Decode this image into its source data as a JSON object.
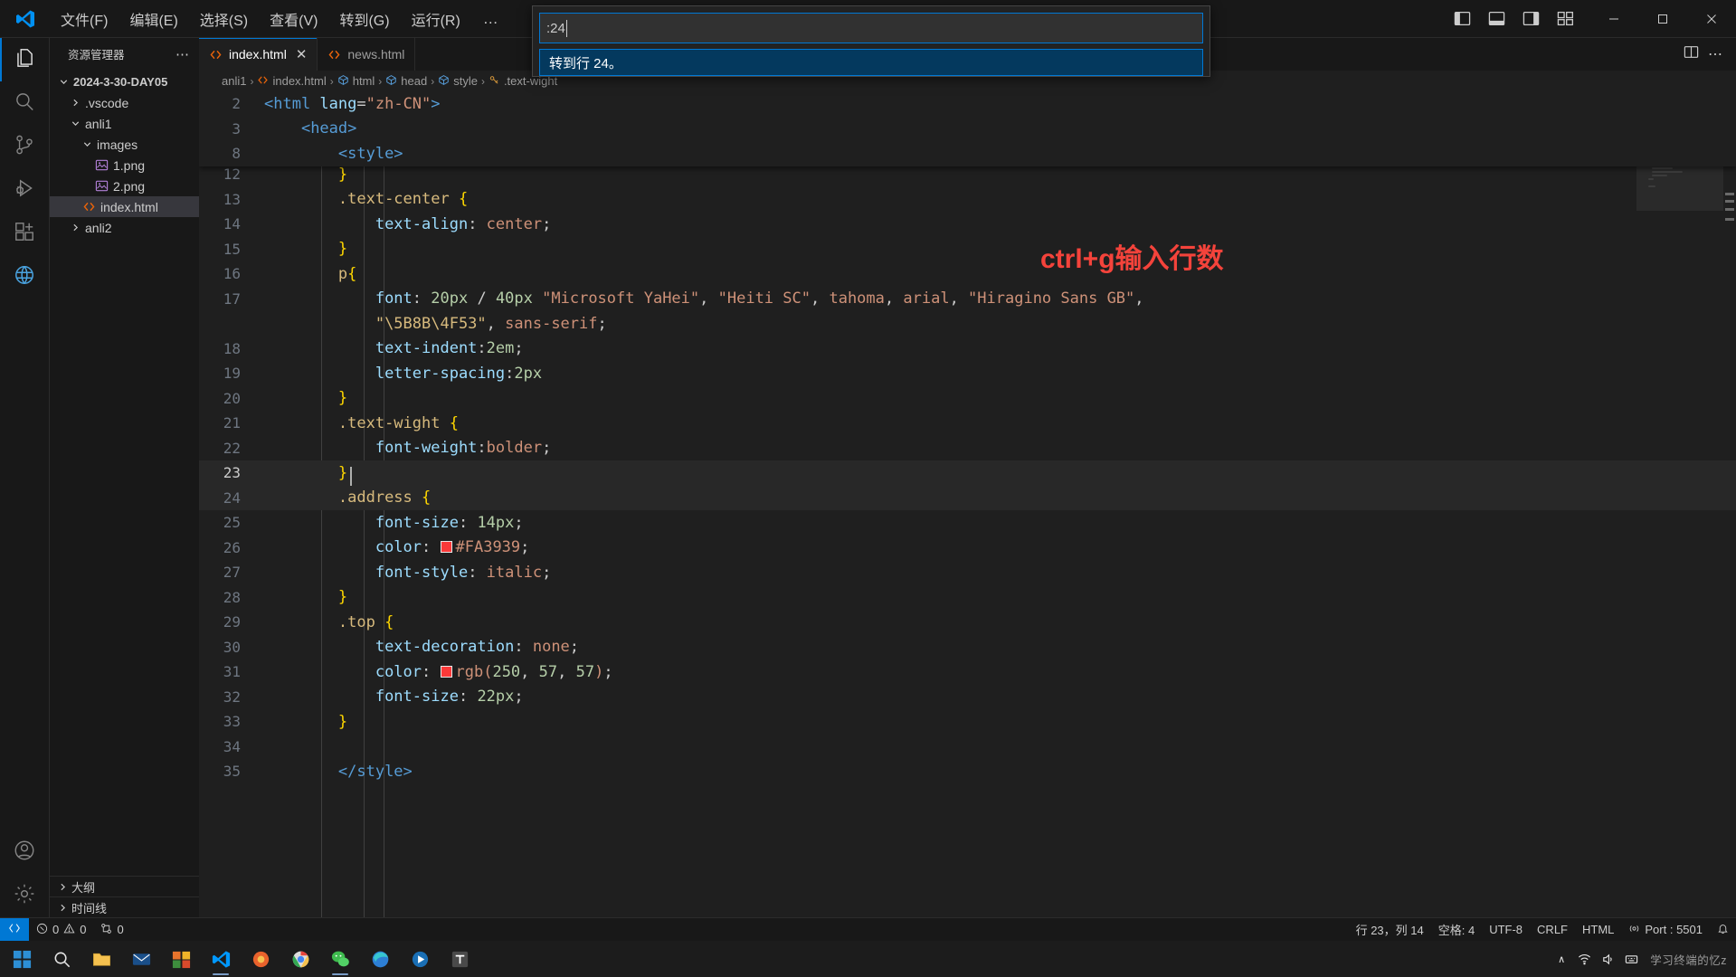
{
  "titlebar": {
    "logo_icon": "vscode-logo-icon",
    "menus": [
      {
        "label": "文件(F)"
      },
      {
        "label": "编辑(E)"
      },
      {
        "label": "选择(S)"
      },
      {
        "label": "查看(V)"
      },
      {
        "label": "转到(G)"
      },
      {
        "label": "运行(R)"
      }
    ],
    "overflow_label": "…",
    "layout_icons": [
      {
        "name": "toggle-primary-sidebar-icon"
      },
      {
        "name": "toggle-panel-icon"
      },
      {
        "name": "toggle-secondary-sidebar-icon"
      },
      {
        "name": "customize-layout-icon"
      }
    ],
    "window_controls": {
      "minimize": "─",
      "maximize": "☐",
      "close": "✕"
    }
  },
  "quick_input": {
    "value": ":24",
    "placeholder": "",
    "suggestion": "转到行 24。"
  },
  "activitybar": {
    "items": [
      {
        "name": "explorer",
        "icon": "files-icon",
        "active": true
      },
      {
        "name": "search",
        "icon": "search-icon",
        "active": false
      },
      {
        "name": "source-control",
        "icon": "source-control-icon",
        "active": false
      },
      {
        "name": "run-and-debug",
        "icon": "debug-icon",
        "active": false
      },
      {
        "name": "extensions",
        "icon": "extensions-icon",
        "active": false
      },
      {
        "name": "live-server",
        "icon": "browser-icon",
        "active": false
      }
    ],
    "bottom_items": [
      {
        "name": "accounts",
        "icon": "account-icon"
      },
      {
        "name": "manage",
        "icon": "gear-icon"
      }
    ]
  },
  "sidebar": {
    "title": "资源管理器",
    "more_actions": "⋯",
    "tree": [
      {
        "label": "2024-3-30-DAY05",
        "indent": 0,
        "chevron": "down",
        "icon": "none",
        "kind": "root",
        "selected": false
      },
      {
        "label": ".vscode",
        "indent": 1,
        "chevron": "right",
        "icon": "none",
        "kind": "folder",
        "selected": false
      },
      {
        "label": "anli1",
        "indent": 1,
        "chevron": "down",
        "icon": "none",
        "kind": "folder",
        "selected": false
      },
      {
        "label": "images",
        "indent": 2,
        "chevron": "down",
        "icon": "none",
        "kind": "folder",
        "selected": false
      },
      {
        "label": "1.png",
        "indent": 3,
        "chevron": "none",
        "icon": "image-icon",
        "kind": "file",
        "selected": false
      },
      {
        "label": "2.png",
        "indent": 3,
        "chevron": "none",
        "icon": "image-icon",
        "kind": "file",
        "selected": false
      },
      {
        "label": "index.html",
        "indent": 2,
        "chevron": "none",
        "icon": "html-icon",
        "kind": "file",
        "selected": true
      },
      {
        "label": "anli2",
        "indent": 1,
        "chevron": "right",
        "icon": "none",
        "kind": "folder",
        "selected": false
      }
    ],
    "sections": [
      {
        "label": "大纲",
        "chevron": "right"
      },
      {
        "label": "时间线",
        "chevron": "right"
      }
    ]
  },
  "editor": {
    "tabs": [
      {
        "label": "index.html",
        "icon": "html-icon",
        "active": true,
        "close": "✕"
      },
      {
        "label": "news.html",
        "icon": "html-icon",
        "active": false,
        "close": ""
      }
    ],
    "tab_actions": [
      {
        "name": "split-editor-icon"
      },
      {
        "name": "more-actions-icon",
        "label": "⋯"
      }
    ],
    "breadcrumbs": [
      {
        "label": "anli1",
        "icon": "none"
      },
      {
        "label": "index.html",
        "icon": "html-icon"
      },
      {
        "label": "html",
        "icon": "symbol-html-icon"
      },
      {
        "label": "head",
        "icon": "symbol-head-icon"
      },
      {
        "label": "style",
        "icon": "symbol-style-icon"
      },
      {
        "label": ".text-wight",
        "icon": "symbol-rule-icon"
      }
    ],
    "separator": "›",
    "sticky_lines": [
      {
        "num": "2",
        "segments": [
          {
            "t": "<html ",
            "c": "t-tag"
          },
          {
            "t": "lang",
            "c": "t-attr"
          },
          {
            "t": "=",
            "c": "t-punc"
          },
          {
            "t": "\"zh-CN\"",
            "c": "t-str"
          },
          {
            "t": ">",
            "c": "t-tag"
          }
        ],
        "indent": 0
      },
      {
        "num": "3",
        "segments": [
          {
            "t": "<head>",
            "c": "t-tag"
          }
        ],
        "indent": 4
      },
      {
        "num": "8",
        "segments": [
          {
            "t": "<style>",
            "c": "t-tag"
          }
        ],
        "indent": 8
      }
    ],
    "lines": [
      {
        "num": "12",
        "indent": 8,
        "segments": [
          {
            "t": "}",
            "c": "t-brace"
          }
        ],
        "partial": true
      },
      {
        "num": "13",
        "indent": 8,
        "segments": [
          {
            "t": ".text-center ",
            "c": "t-sel"
          },
          {
            "t": "{",
            "c": "t-brace"
          }
        ]
      },
      {
        "num": "14",
        "indent": 12,
        "segments": [
          {
            "t": "text-align",
            "c": "t-prop"
          },
          {
            "t": ": ",
            "c": "t-punc"
          },
          {
            "t": "center",
            "c": "t-val"
          },
          {
            "t": ";",
            "c": "t-punc"
          }
        ]
      },
      {
        "num": "15",
        "indent": 8,
        "segments": [
          {
            "t": "}",
            "c": "t-brace"
          }
        ]
      },
      {
        "num": "16",
        "indent": 8,
        "segments": [
          {
            "t": "p",
            "c": "t-sel"
          },
          {
            "t": "{",
            "c": "t-brace"
          }
        ]
      },
      {
        "num": "17",
        "indent": 12,
        "segments": [
          {
            "t": "font",
            "c": "t-prop"
          },
          {
            "t": ": ",
            "c": "t-punc"
          },
          {
            "t": "20px",
            "c": "t-num"
          },
          {
            "t": " / ",
            "c": "t-punc"
          },
          {
            "t": "40px",
            "c": "t-num"
          },
          {
            "t": " ",
            "c": "t-punc"
          },
          {
            "t": "\"Microsoft YaHei\"",
            "c": "t-val"
          },
          {
            "t": ", ",
            "c": "t-punc"
          },
          {
            "t": "\"Heiti SC\"",
            "c": "t-val"
          },
          {
            "t": ", ",
            "c": "t-punc"
          },
          {
            "t": "tahoma",
            "c": "t-val"
          },
          {
            "t": ", ",
            "c": "t-punc"
          },
          {
            "t": "arial",
            "c": "t-val"
          },
          {
            "t": ", ",
            "c": "t-punc"
          },
          {
            "t": "\"Hiragino Sans GB\"",
            "c": "t-val"
          },
          {
            "t": ",",
            "c": "t-punc"
          }
        ]
      },
      {
        "num": "",
        "indent": 12,
        "wrapped": true,
        "segments": [
          {
            "t": "\"\\5B8B\\4F53\"",
            "c": "t-sel"
          },
          {
            "t": ", ",
            "c": "t-punc"
          },
          {
            "t": "sans-serif",
            "c": "t-val"
          },
          {
            "t": ";",
            "c": "t-punc"
          }
        ]
      },
      {
        "num": "18",
        "indent": 12,
        "segments": [
          {
            "t": "text-indent",
            "c": "t-prop"
          },
          {
            "t": ":",
            "c": "t-punc"
          },
          {
            "t": "2em",
            "c": "t-num"
          },
          {
            "t": ";",
            "c": "t-punc"
          }
        ]
      },
      {
        "num": "19",
        "indent": 12,
        "segments": [
          {
            "t": "letter-spacing",
            "c": "t-prop"
          },
          {
            "t": ":",
            "c": "t-punc"
          },
          {
            "t": "2px",
            "c": "t-num"
          }
        ]
      },
      {
        "num": "20",
        "indent": 8,
        "segments": [
          {
            "t": "}",
            "c": "t-brace"
          }
        ]
      },
      {
        "num": "21",
        "indent": 8,
        "segments": [
          {
            "t": ".text-wight ",
            "c": "t-sel"
          },
          {
            "t": "{",
            "c": "t-brace"
          }
        ]
      },
      {
        "num": "22",
        "indent": 12,
        "segments": [
          {
            "t": "font-weight",
            "c": "t-prop"
          },
          {
            "t": ":",
            "c": "t-punc"
          },
          {
            "t": "bolder",
            "c": "t-val"
          },
          {
            "t": ";",
            "c": "t-punc"
          }
        ]
      },
      {
        "num": "23",
        "indent": 8,
        "current": true,
        "segments": [
          {
            "t": "}",
            "c": "t-brace"
          }
        ]
      },
      {
        "num": "24",
        "indent": 8,
        "highlight": true,
        "segments": [
          {
            "t": ".address ",
            "c": "t-sel"
          },
          {
            "t": "{",
            "c": "t-brace"
          }
        ]
      },
      {
        "num": "25",
        "indent": 12,
        "segments": [
          {
            "t": "font-size",
            "c": "t-prop"
          },
          {
            "t": ": ",
            "c": "t-punc"
          },
          {
            "t": "14px",
            "c": "t-num"
          },
          {
            "t": ";",
            "c": "t-punc"
          }
        ]
      },
      {
        "num": "26",
        "indent": 12,
        "swatch": "#FA3939",
        "segments": [
          {
            "t": "color",
            "c": "t-prop"
          },
          {
            "t": ": ",
            "c": "t-punc"
          },
          {
            "t": "@SWATCH@",
            "c": "swatch"
          },
          {
            "t": "#FA3939",
            "c": "t-val"
          },
          {
            "t": ";",
            "c": "t-punc"
          }
        ]
      },
      {
        "num": "27",
        "indent": 12,
        "segments": [
          {
            "t": "font-style",
            "c": "t-prop"
          },
          {
            "t": ": ",
            "c": "t-punc"
          },
          {
            "t": "italic",
            "c": "t-val"
          },
          {
            "t": ";",
            "c": "t-punc"
          }
        ]
      },
      {
        "num": "28",
        "indent": 8,
        "segments": [
          {
            "t": "}",
            "c": "t-brace"
          }
        ]
      },
      {
        "num": "29",
        "indent": 8,
        "segments": [
          {
            "t": ".top ",
            "c": "t-sel"
          },
          {
            "t": "{",
            "c": "t-brace"
          }
        ]
      },
      {
        "num": "30",
        "indent": 12,
        "segments": [
          {
            "t": "text-decoration",
            "c": "t-prop"
          },
          {
            "t": ": ",
            "c": "t-punc"
          },
          {
            "t": "none",
            "c": "t-val"
          },
          {
            "t": ";",
            "c": "t-punc"
          }
        ]
      },
      {
        "num": "31",
        "indent": 12,
        "swatch": "#FA3939",
        "segments": [
          {
            "t": "color",
            "c": "t-prop"
          },
          {
            "t": ": ",
            "c": "t-punc"
          },
          {
            "t": "@SWATCH@",
            "c": "swatch"
          },
          {
            "t": "rgb(",
            "c": "t-val"
          },
          {
            "t": "250",
            "c": "t-num"
          },
          {
            "t": ", ",
            "c": "t-punc"
          },
          {
            "t": "57",
            "c": "t-num"
          },
          {
            "t": ", ",
            "c": "t-punc"
          },
          {
            "t": "57",
            "c": "t-num"
          },
          {
            "t": ")",
            "c": "t-val"
          },
          {
            "t": ";",
            "c": "t-punc"
          }
        ]
      },
      {
        "num": "32",
        "indent": 12,
        "segments": [
          {
            "t": "font-size",
            "c": "t-prop"
          },
          {
            "t": ": ",
            "c": "t-punc"
          },
          {
            "t": "22px",
            "c": "t-num"
          },
          {
            "t": ";",
            "c": "t-punc"
          }
        ]
      },
      {
        "num": "33",
        "indent": 8,
        "segments": [
          {
            "t": "}",
            "c": "t-brace"
          }
        ]
      },
      {
        "num": "34",
        "indent": 8,
        "segments": []
      },
      {
        "num": "35",
        "indent": 8,
        "partial_bottom": true,
        "segments": [
          {
            "t": "</style>",
            "c": "t-tag"
          }
        ]
      }
    ],
    "annotation": "ctrl+g输入行数"
  },
  "statusbar": {
    "remote_icon": "remote-window-icon",
    "left": [
      {
        "name": "problems",
        "icon": "error-icon",
        "label": "0",
        "icon2": "warning-icon",
        "label2": "0"
      },
      {
        "name": "ports",
        "icon": "ports-icon",
        "label": "0"
      }
    ],
    "problems_errors": "0",
    "problems_warnings": "0",
    "ports_count": "0",
    "right": [
      {
        "name": "editor-position",
        "label": "行 23，列 14"
      },
      {
        "name": "indentation",
        "label": "空格: 4"
      },
      {
        "name": "encoding",
        "label": "UTF-8"
      },
      {
        "name": "eol",
        "label": "CRLF"
      },
      {
        "name": "language-mode",
        "label": "HTML"
      },
      {
        "name": "live-server-port",
        "label": "Port : 5501",
        "icon": "broadcast-icon"
      },
      {
        "name": "notifications",
        "label": "",
        "icon": "bell-icon"
      }
    ]
  },
  "taskbar": {
    "items": [
      {
        "name": "start-button",
        "icon": "windows-icon"
      },
      {
        "name": "search-button",
        "icon": "search-icon"
      },
      {
        "name": "file-explorer",
        "icon": "folder-icon"
      },
      {
        "name": "mail-app",
        "icon": "mail-icon"
      },
      {
        "name": "office-app",
        "icon": "office-icon"
      },
      {
        "name": "vscode-app",
        "icon": "vscode-logo-icon",
        "running": true
      },
      {
        "name": "browser-app",
        "icon": "firefox-icon"
      },
      {
        "name": "chrome-app",
        "icon": "chrome-icon"
      },
      {
        "name": "wechat-app",
        "icon": "wechat-icon",
        "running": true
      },
      {
        "name": "edge-app",
        "icon": "edge-icon"
      },
      {
        "name": "media-app",
        "icon": "media-icon"
      },
      {
        "name": "typora-app",
        "icon": "typora-icon"
      }
    ],
    "tray": {
      "chevron": "∧",
      "icons": [
        {
          "name": "network-icon"
        },
        {
          "name": "volume-icon"
        },
        {
          "name": "ime-icon"
        }
      ],
      "watermark": "学习终端的忆z"
    }
  }
}
